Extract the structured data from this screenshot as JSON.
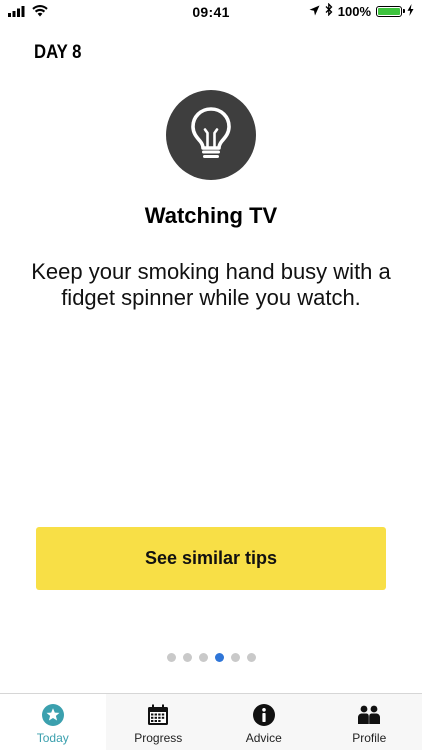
{
  "status_bar": {
    "time": "09:41",
    "battery_percent": "100%",
    "battery_level": 1.0
  },
  "day_label": "DAY 8",
  "tip": {
    "icon": "lightbulb-icon",
    "title": "Watching TV",
    "body": "Keep your smoking hand busy with a fidget spinner while you watch."
  },
  "cta": {
    "label": "See similar tips",
    "color": "#f8df46"
  },
  "pagination": {
    "total": 6,
    "active_index": 3
  },
  "tab_bar": {
    "active_color": "#3ba0ae",
    "tabs": [
      {
        "label": "Today",
        "icon": "star-icon",
        "active": true
      },
      {
        "label": "Progress",
        "icon": "calendar-icon",
        "active": false
      },
      {
        "label": "Advice",
        "icon": "info-icon",
        "active": false
      },
      {
        "label": "Profile",
        "icon": "people-icon",
        "active": false
      }
    ]
  }
}
